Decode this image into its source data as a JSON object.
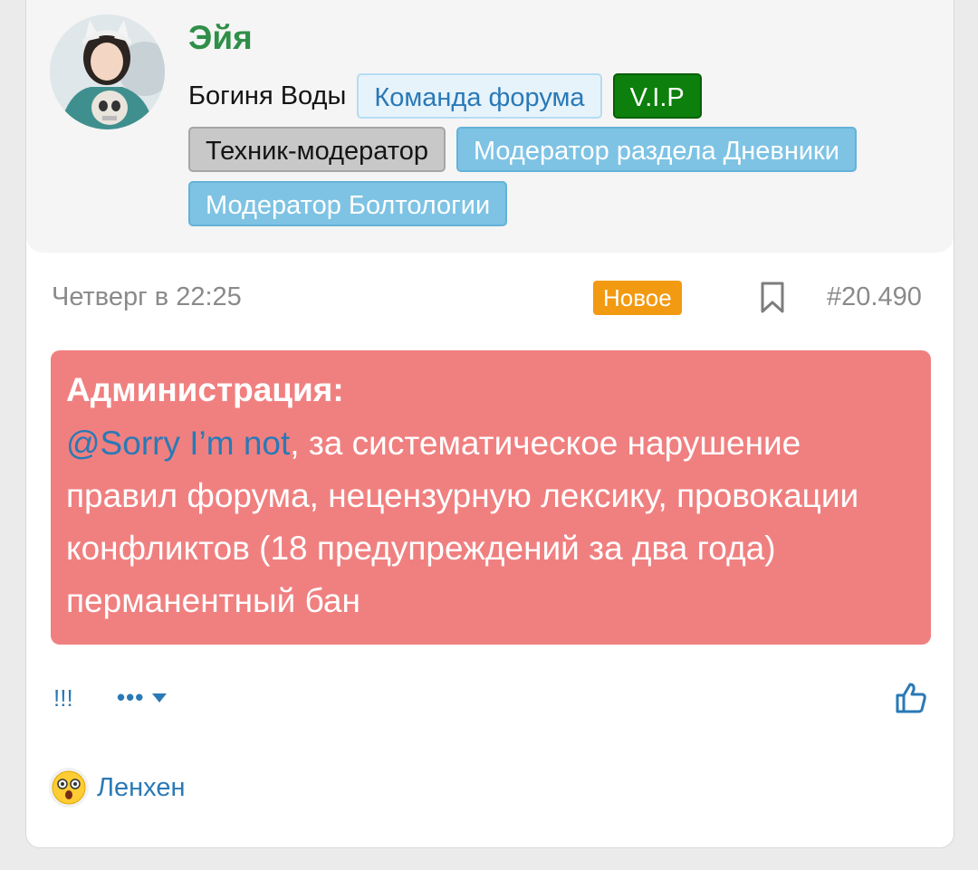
{
  "post": {
    "username": "Эйя",
    "user_title": "Богиня Воды",
    "badges_row1": [
      "Команда форума",
      "V.I.P"
    ],
    "badges_row2": [
      "Техник-модератор",
      "Модератор раздела Дневники"
    ],
    "badges_row3": [
      "Модератор Болтологии"
    ],
    "date": "Четверг в 22:25",
    "new_label": "Новое",
    "post_number": "#20.490",
    "notice": {
      "heading": "Администрация:",
      "mention": "@Sorry I’m not",
      "text": ", за систематическое нарушение правил форума, нецензурную лексику, провокации конфликтов (18 предупреждений за два года) перманентный бан"
    },
    "actions": {
      "report_label": "!!!",
      "more_label": "•••"
    },
    "reaction": {
      "emoji": "astonished-face",
      "user": "Ленхен"
    }
  },
  "colors": {
    "username": "#2f8f48",
    "link": "#2a79b6",
    "notice_bg": "#f08080",
    "new_badge": "#f29a12",
    "vip_badge": "#0c7f0c",
    "moderator_badge": "#7ec3e4"
  }
}
